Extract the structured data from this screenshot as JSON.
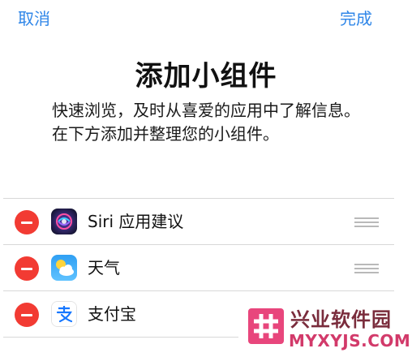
{
  "nav": {
    "cancel_label": "取消",
    "done_label": "完成"
  },
  "header": {
    "title": "添加小组件",
    "description": "快速浏览，及时从喜爱的应用中了解信息。在下方添加并整理您的小组件。"
  },
  "widgets": [
    {
      "label": "Siri 应用建议",
      "icon": "siri-icon",
      "has_handle": true
    },
    {
      "label": "天气",
      "icon": "weather-icon",
      "has_handle": true
    },
    {
      "label": "支付宝",
      "icon": "alipay-icon",
      "has_handle": false
    }
  ],
  "watermark": {
    "brand": "兴业软件园",
    "url": "MYXYJS.COM",
    "logo": "hash-logo"
  },
  "colors": {
    "accent": "#2f86e8",
    "delete": "#f23b33",
    "watermark": "#d23a6a"
  }
}
